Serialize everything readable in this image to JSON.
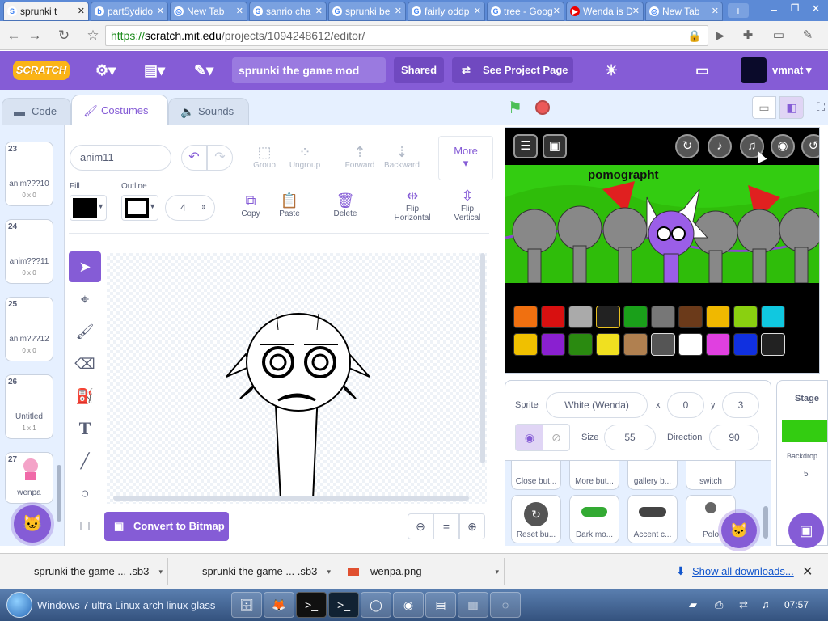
{
  "browser": {
    "tabs": [
      {
        "label": "sprunki t",
        "active": true
      },
      {
        "label": "part5ydido"
      },
      {
        "label": "New Tab"
      },
      {
        "label": "sanrio cha"
      },
      {
        "label": "sprunki be"
      },
      {
        "label": "fairly oddp"
      },
      {
        "label": "tree - Goog"
      },
      {
        "label": "Wenda is D"
      },
      {
        "label": "New Tab"
      }
    ],
    "url_scheme": "https://",
    "url_host": "scratch.mit.edu",
    "url_path": "/projects/1094248612/editor/"
  },
  "menubar": {
    "logo": "SCRATCH",
    "project_title": "sprunki the game mod",
    "shared": "Shared",
    "see_project": "See Project Page",
    "username": "vmnat"
  },
  "editor_tabs": {
    "code": "Code",
    "costumes": "Costumes",
    "sounds": "Sounds"
  },
  "costumes": [
    {
      "num": "23",
      "name": "anim???10",
      "size": "0 x 0"
    },
    {
      "num": "24",
      "name": "anim???11",
      "size": "0 x 0"
    },
    {
      "num": "25",
      "name": "anim???12",
      "size": "0 x 0"
    },
    {
      "num": "26",
      "name": "Untitled",
      "size": "1 x 1"
    },
    {
      "num": "27",
      "name": "wenpa",
      "size": ""
    }
  ],
  "paint": {
    "costume_name": "anim11",
    "group": "Group",
    "ungroup": "Ungroup",
    "forward": "Forward",
    "backward": "Backward",
    "more": "More",
    "fill_label": "Fill",
    "outline_label": "Outline",
    "stroke_width": "4",
    "copy": "Copy",
    "paste": "Paste",
    "delete": "Delete",
    "flip_h_1": "Flip",
    "flip_h_2": "Horizontal",
    "flip_v_1": "Flip",
    "flip_v_2": "Vertical",
    "convert": "Convert to Bitmap",
    "fill_color": "#000000",
    "outline_color": "#000000"
  },
  "stage": {
    "title": "pomographt",
    "bg_color": "#33cc11"
  },
  "sprite_info": {
    "sprite_label": "Sprite",
    "sprite_name": "White (Wenda)",
    "x_label": "x",
    "x": "0",
    "y_label": "y",
    "y": "3",
    "size_label": "Size",
    "size": "55",
    "direction_label": "Direction",
    "direction": "90"
  },
  "sprites_row1": [
    "Close but...",
    "More but...",
    "gallery b...",
    "switch"
  ],
  "sprites_row2": [
    "Reset bu...",
    "Dark mo...",
    "Accent c...",
    "Polo"
  ],
  "stage_panel": {
    "title": "Stage",
    "backdrops_label": "Backdrop",
    "backdrops_count": "5"
  },
  "downloads": [
    {
      "name": "sprunki the game ... .sb3"
    },
    {
      "name": "sprunki the game ... .sb3"
    },
    {
      "name": "wenpa.png"
    }
  ],
  "downloads_show_all": "Show all downloads...",
  "taskbar": {
    "os_name": "Windows 7 ultra Linux arch linux glass",
    "clock": "07:57"
  }
}
